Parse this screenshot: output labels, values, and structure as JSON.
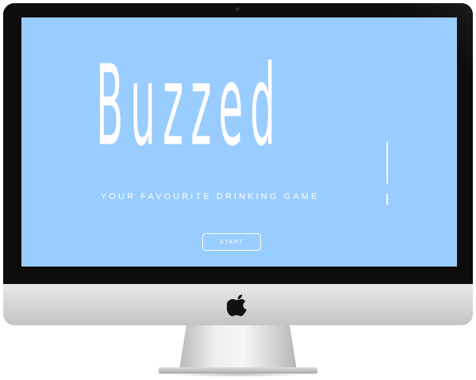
{
  "screen": {
    "background_color": "#99ccff",
    "text_color": "#ffffff",
    "title": "Buzzed",
    "exclamation": "!",
    "tagline": "YOUR FAVOURITE DRINKING GAME",
    "start_label": "START"
  },
  "device": {
    "bezel_color": "#0d0d0d",
    "chin_color": "#d4d4d6",
    "logo_icon": "apple-logo-icon"
  }
}
